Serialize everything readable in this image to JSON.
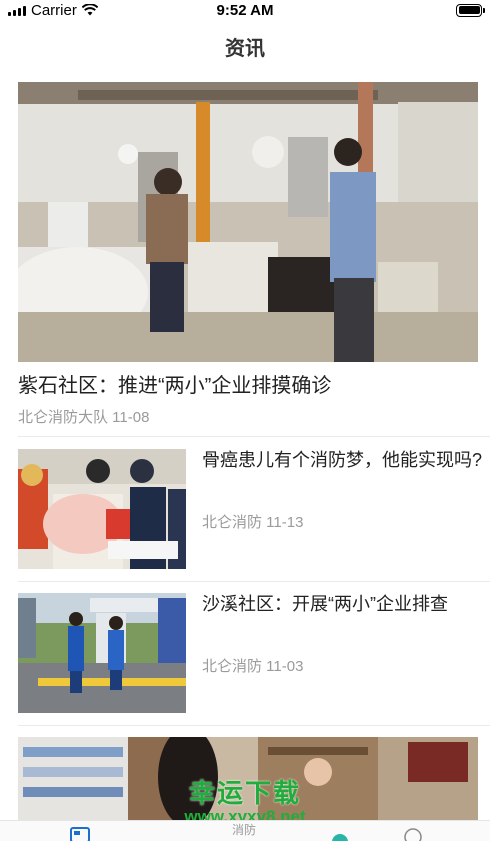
{
  "status_bar": {
    "carrier": "Carrier",
    "time": "9:52 AM"
  },
  "nav": {
    "title": "资讯"
  },
  "feature": {
    "title": "紫石社区：推进“两小”企业排摸确诊",
    "meta": "北仑消防大队 11-08"
  },
  "list": [
    {
      "title": "骨癌患儿有个消防梦，他能实现吗?",
      "meta": "北仑消防  11-13"
    },
    {
      "title": "沙溪社区：开展“两小”企业排查",
      "meta": "北仑消防  11-03"
    }
  ],
  "watermark": {
    "brand": "幸运下载",
    "url": "www.xyxy8.net"
  },
  "tabs": [
    {
      "icon": "news-icon",
      "label": ""
    },
    {
      "icon": "report-icon",
      "label": "消防"
    },
    {
      "icon": "home-icon",
      "label": ""
    },
    {
      "icon": "profile-icon",
      "label": ""
    }
  ],
  "colors": {
    "accent": "#1a6fcf",
    "watermark": "#1fae3b"
  }
}
